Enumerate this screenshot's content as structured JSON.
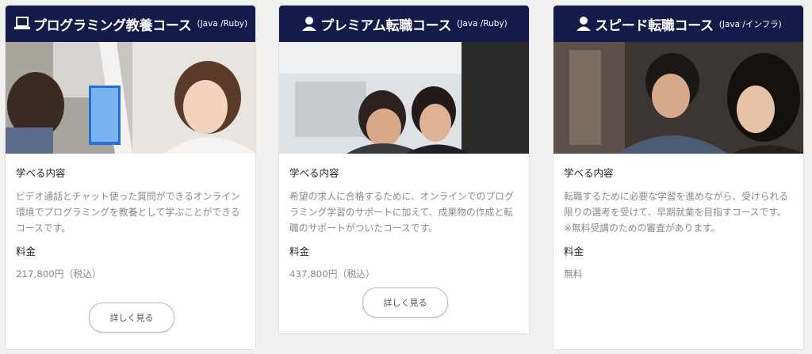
{
  "courses": [
    {
      "icon": "laptop-icon",
      "title": "プログラミング教養コース",
      "sub": "(Java /Ruby)",
      "learn_label": "学べる内容",
      "description": "ビデオ通話とチャット使った質問ができるオンライン環境でプログラミングを教養として学ぶことができるコースです。",
      "note": "",
      "price_label": "料金",
      "price": "217,800円（税込）",
      "button": "詳しく見る"
    },
    {
      "icon": "person-icon",
      "title": "プレミアム転職コース",
      "sub": "(Java /Ruby)",
      "learn_label": "学べる内容",
      "description": "希望の求人に合格するために、オンラインでのプログラミング学習のサポートに加えて、成果物の作成と転職のサポートがついたコースです。",
      "note": "",
      "price_label": "料金",
      "price": "437,800円（税込）",
      "button": "詳しく見る"
    },
    {
      "icon": "person-icon",
      "title": "スピード転職コース",
      "sub": "(Java /インフラ)",
      "learn_label": "学べる内容",
      "description": "転職するために必要な学習を進めながら、受けられる限りの選考を受けて、早期就業を目指すコースです。",
      "note": "※無料受講のための審査があります。",
      "price_label": "料金",
      "price": "無料",
      "button": ""
    }
  ],
  "colors": {
    "header_bg": "#141b4a",
    "page_bg": "#f3f1ef",
    "muted_text": "#8a8a8a"
  }
}
